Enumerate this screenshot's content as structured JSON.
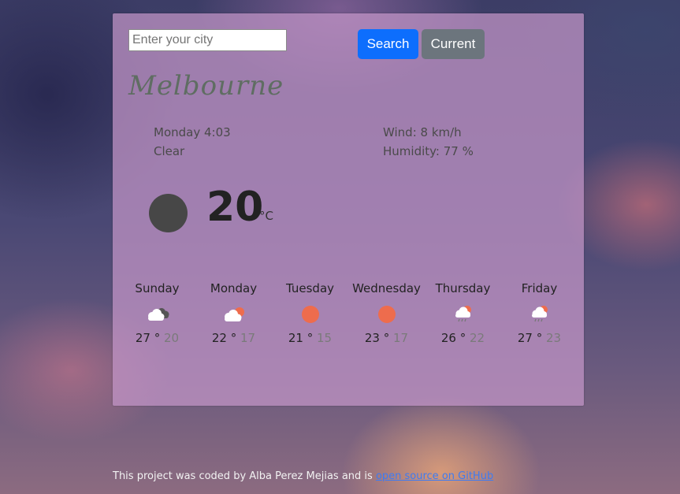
{
  "search": {
    "placeholder": "Enter your city",
    "value": ""
  },
  "buttons": {
    "search_label": "Search",
    "current_label": "Current"
  },
  "city": "Melbourne",
  "details": {
    "datetime": "Monday 4:03",
    "description": "Clear",
    "wind": "Wind: 8 km/h",
    "humidity": "Humidity: 77 %"
  },
  "current": {
    "temp": "20",
    "unit": "°C",
    "icon": "clear-night-icon"
  },
  "forecast": [
    {
      "day": "Sunday",
      "max": "27",
      "min": "20",
      "icon": "broken-clouds-icon"
    },
    {
      "day": "Monday",
      "max": "22",
      "min": "17",
      "icon": "partly-cloudy-icon"
    },
    {
      "day": "Tuesday",
      "max": "21",
      "min": "15",
      "icon": "sun-icon"
    },
    {
      "day": "Wednesday",
      "max": "23",
      "min": "17",
      "icon": "sun-icon"
    },
    {
      "day": "Thursday",
      "max": "26",
      "min": "22",
      "icon": "rain-sun-icon"
    },
    {
      "day": "Friday",
      "max": "27",
      "min": "23",
      "icon": "rain-sun-icon"
    }
  ],
  "footer": {
    "text": "This project was coded by Alba Perez Mejias and is ",
    "link_text": "open source on GitHub"
  },
  "colors": {
    "search_button": "#0d6efd",
    "current_button": "#6c757d",
    "sun": "#ee6c4d",
    "link": "#3d7bf2"
  }
}
